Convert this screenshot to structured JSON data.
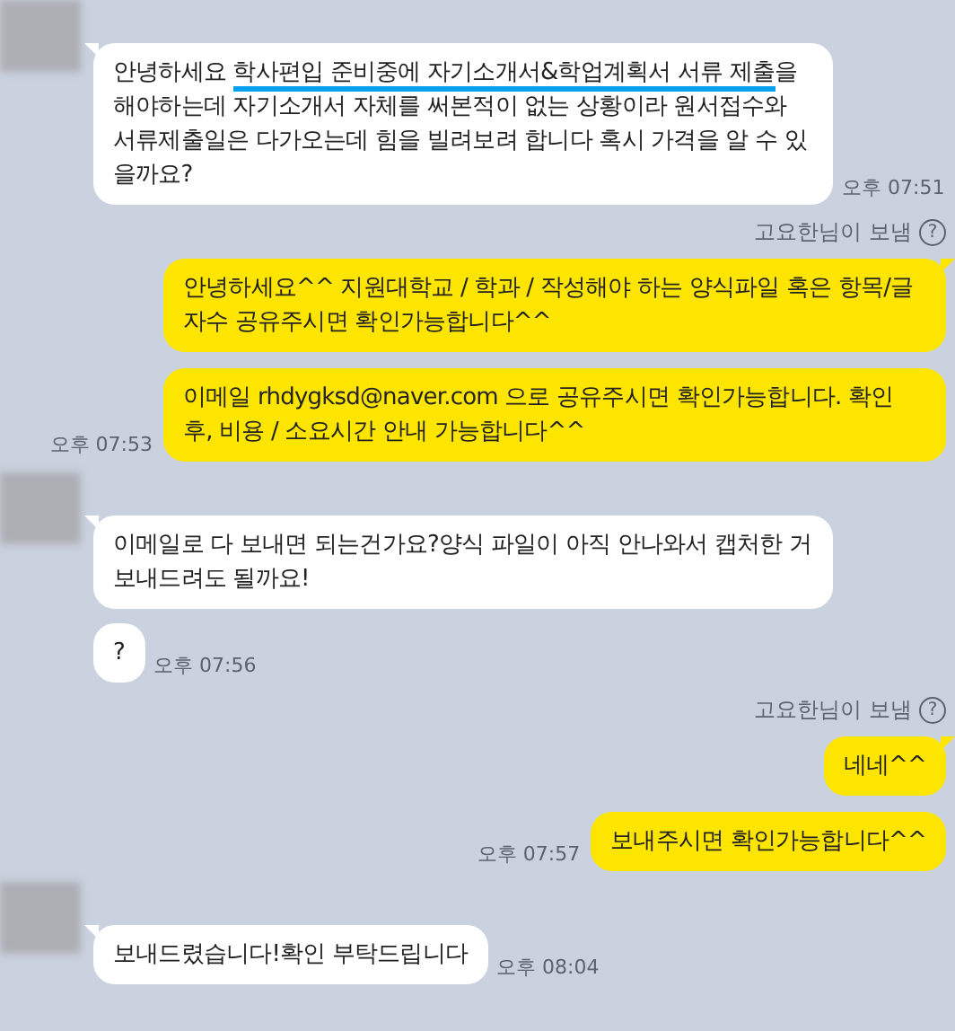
{
  "messages": [
    {
      "kind": "received",
      "avatar": true,
      "time": "오후 07:51",
      "segments": [
        {
          "text": "안녕하세요 ",
          "marked": false
        },
        {
          "text": "학사편입 준비중에 자기소개서&학업계획서 서류 제출",
          "marked": true
        },
        {
          "text": "을 해야하는데 자기소개서 자체를 써본적이 없는 상황이라 원서접수와 서류제출일은 다가오는데 힘을 빌려보려 합니다 혹시 가격을 알 수 있을까요?",
          "marked": false
        }
      ]
    },
    {
      "kind": "sender_label",
      "text": "고요한님이 보냄",
      "icon": "?"
    },
    {
      "kind": "sent",
      "tail": true,
      "segments": [
        {
          "text": "안녕하세요^^ 지원대학교 / 학과 / 작성해야 하는 양식파일 혹은 항목/글자수 공유주시면 확인가능합니다^^",
          "marked": false
        }
      ]
    },
    {
      "kind": "sent",
      "tail": false,
      "time": "오후 07:53",
      "segments": [
        {
          "text": "이메일 rhdygksd@naver.com 으로 공유주시면 확인가능합니다. 확인 후, 비용 / 소요시간 안내 가능합니다^^",
          "marked": false
        }
      ]
    },
    {
      "kind": "received",
      "avatar": true,
      "segments": [
        {
          "text": "이메일로 다 보내면 되는건가요?양식 파일이 아직 안나와서 캡처한 거 보내드려도 될까요!",
          "marked": false
        }
      ]
    },
    {
      "kind": "received",
      "avatar": false,
      "time": "오후 07:56",
      "segments": [
        {
          "text": "?",
          "marked": false
        }
      ]
    },
    {
      "kind": "sender_label",
      "text": "고요한님이 보냄",
      "icon": "?"
    },
    {
      "kind": "sent",
      "tail": true,
      "segments": [
        {
          "text": "네네^^",
          "marked": false
        }
      ]
    },
    {
      "kind": "sent",
      "tail": false,
      "time": "오후 07:57",
      "segments": [
        {
          "text": "보내주시면 확인가능합니다^^",
          "marked": false
        }
      ]
    },
    {
      "kind": "received",
      "avatar": true,
      "time": "오후 08:04",
      "segments": [
        {
          "text": "보내드렸습니다!확인 부탁드립니다",
          "marked": false
        }
      ]
    }
  ]
}
